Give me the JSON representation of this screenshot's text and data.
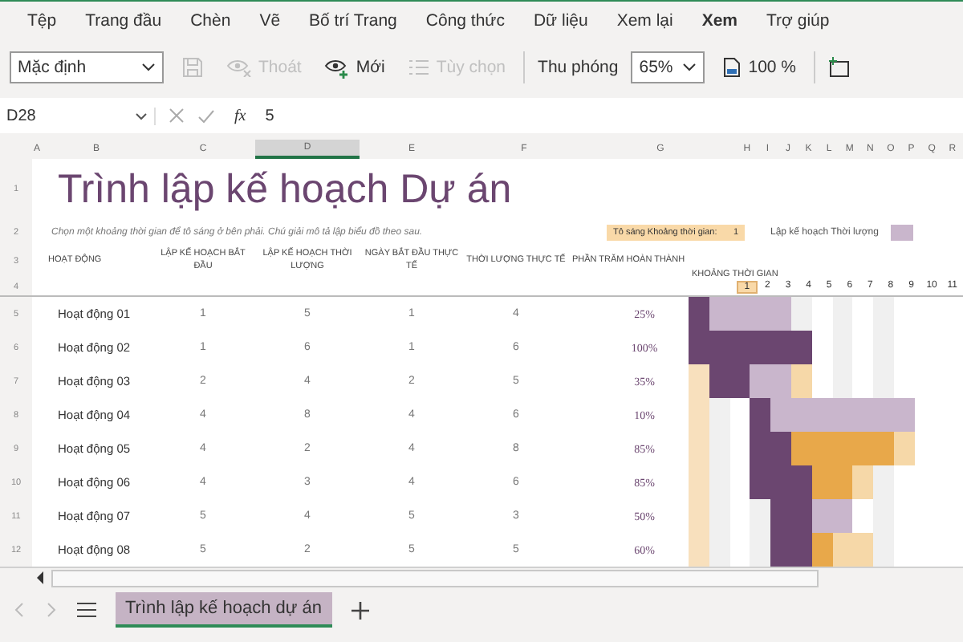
{
  "menu": [
    {
      "label": "Tệp",
      "selected": false
    },
    {
      "label": "Trang đầu",
      "selected": false
    },
    {
      "label": "Chèn",
      "selected": false
    },
    {
      "label": "Vẽ",
      "selected": false
    },
    {
      "label": "Bố trí Trang",
      "selected": false
    },
    {
      "label": "Công thức",
      "selected": false
    },
    {
      "label": "Dữ liệu",
      "selected": false
    },
    {
      "label": "Xem lại",
      "selected": false
    },
    {
      "label": "Xem",
      "selected": true
    },
    {
      "label": "Trợ giúp",
      "selected": false
    }
  ],
  "ribbon": {
    "style_select": "Mặc định",
    "buttons": [
      {
        "kind": "save",
        "disabled": true
      },
      {
        "kind": "exit",
        "label": "Thoát",
        "disabled": true
      },
      {
        "kind": "new",
        "label": "Mới",
        "disabled": false
      },
      {
        "kind": "options",
        "label": "Tùy chọn",
        "disabled": true
      }
    ],
    "zoom_label": "Thu phóng",
    "zoom_value": "65%",
    "fit_label": "100 %"
  },
  "formula_bar": {
    "cell_ref": "D28",
    "function_label": "fx",
    "value": "5"
  },
  "column_headers": [
    {
      "label": "A",
      "selected": false
    },
    {
      "label": "B",
      "selected": false
    },
    {
      "label": "C",
      "selected": false
    },
    {
      "label": "D",
      "selected": true
    },
    {
      "label": "E",
      "selected": false
    },
    {
      "label": "F",
      "selected": false
    },
    {
      "label": "G",
      "selected": false
    },
    {
      "label": "H",
      "selected": false
    },
    {
      "label": "I",
      "selected": false
    },
    {
      "label": "J",
      "selected": false
    },
    {
      "label": "K",
      "selected": false
    },
    {
      "label": "L",
      "selected": false
    },
    {
      "label": "M",
      "selected": false
    },
    {
      "label": "N",
      "selected": false
    },
    {
      "label": "O",
      "selected": false
    },
    {
      "label": "P",
      "selected": false
    },
    {
      "label": "Q",
      "selected": false
    },
    {
      "label": "R",
      "selected": false
    }
  ],
  "row_numbers": [
    "1",
    "2",
    "3",
    "4",
    "5",
    "6",
    "7",
    "8",
    "9",
    "10",
    "11",
    "12"
  ],
  "sheet": {
    "title": "Trình lập kế hoạch Dự án",
    "subtitle": "Chọn một khoảng thời gian để tô sáng ở bên phải.  Chú giải mô tả lập biểu đồ theo sau.",
    "highlight_label": "Tô sáng Khoảng thời gian:",
    "highlight_value": "1",
    "legend_label": "Lập kế hoạch Thời lượng",
    "columns": [
      "HOẠT ĐỘNG",
      "LẬP KẾ HOẠCH BẮT ĐẦU",
      "LẬP KẾ HOẠCH THỜI LƯỢNG",
      "NGÀY BẮT ĐẦU THỰC TẾ",
      "THỜI LƯỢNG THỰC TẾ",
      "PHẦN TRĂM HOÀN THÀNH"
    ],
    "period_header": "KHOẢNG THỜI GIAN",
    "periods": [
      {
        "label": "1",
        "selected": true
      },
      {
        "label": "2",
        "selected": false
      },
      {
        "label": "3",
        "selected": false
      },
      {
        "label": "4",
        "selected": false
      },
      {
        "label": "5",
        "selected": false
      },
      {
        "label": "6",
        "selected": false
      },
      {
        "label": "7",
        "selected": false
      },
      {
        "label": "8",
        "selected": false
      },
      {
        "label": "9",
        "selected": false
      },
      {
        "label": "10",
        "selected": false
      },
      {
        "label": "11",
        "selected": false
      }
    ],
    "rows": [
      {
        "activity": "Hoạt động 01",
        "plan_start": "1",
        "plan_duration": "5",
        "actual_start": "1",
        "actual_duration": "4",
        "percent_complete": "25%"
      },
      {
        "activity": "Hoạt động 02",
        "plan_start": "1",
        "plan_duration": "6",
        "actual_start": "1",
        "actual_duration": "6",
        "percent_complete": "100%"
      },
      {
        "activity": "Hoạt động 03",
        "plan_start": "2",
        "plan_duration": "4",
        "actual_start": "2",
        "actual_duration": "5",
        "percent_complete": "35%"
      },
      {
        "activity": "Hoạt động 04",
        "plan_start": "4",
        "plan_duration": "8",
        "actual_start": "4",
        "actual_duration": "6",
        "percent_complete": "10%"
      },
      {
        "activity": "Hoạt động 05",
        "plan_start": "4",
        "plan_duration": "2",
        "actual_start": "4",
        "actual_duration": "8",
        "percent_complete": "85%"
      },
      {
        "activity": "Hoạt động 06",
        "plan_start": "4",
        "plan_duration": "3",
        "actual_start": "4",
        "actual_duration": "6",
        "percent_complete": "85%"
      },
      {
        "activity": "Hoạt động 07",
        "plan_start": "5",
        "plan_duration": "4",
        "actual_start": "5",
        "actual_duration": "3",
        "percent_complete": "50%"
      },
      {
        "activity": "Hoạt động 08",
        "plan_start": "5",
        "plan_duration": "2",
        "actual_start": "5",
        "actual_duration": "5",
        "percent_complete": "60%"
      }
    ]
  },
  "sheet_tabs": [
    {
      "label": "Trình lập kế hoạch dự án",
      "selected": true
    }
  ]
}
